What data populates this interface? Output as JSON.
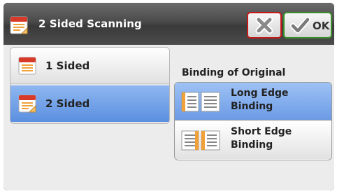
{
  "header": {
    "title": "2 Sided Scanning",
    "icon": "two-sided-doc-icon",
    "ok_label": "OK",
    "cancel_icon": "x-icon"
  },
  "sides": {
    "items": [
      {
        "label": "1 Sided",
        "icon": "single-page-icon",
        "selected": false
      },
      {
        "label": "2 Sided",
        "icon": "two-sided-page-icon",
        "selected": true
      }
    ]
  },
  "binding": {
    "title": "Binding of Original",
    "options": [
      {
        "label": "Long Edge Binding",
        "icon": "long-edge-binding-icon",
        "selected": true
      },
      {
        "label": "Short Edge Binding",
        "icon": "short-edge-binding-icon",
        "selected": false
      }
    ]
  },
  "colors": {
    "selected": "#6b9be6",
    "cancel_border": "#c61a1a",
    "ok_border": "#3a8f2a",
    "doc_orange": "#f0a13a",
    "doc_red": "#d83a2a"
  }
}
